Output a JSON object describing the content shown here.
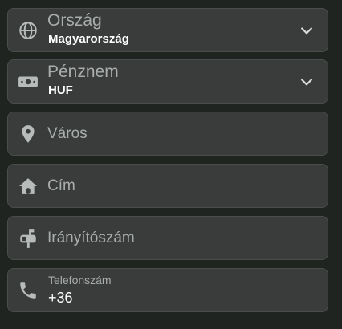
{
  "form": {
    "country": {
      "label": "Ország",
      "value": "Magyarország",
      "icon": "globe-icon"
    },
    "currency": {
      "label": "Pénznem",
      "value": "HUF",
      "icon": "banknote-icon"
    },
    "city": {
      "placeholder": "Város",
      "icon": "map-pin-icon"
    },
    "address": {
      "placeholder": "Cím",
      "icon": "home-icon"
    },
    "zip": {
      "placeholder": "Irányítószám",
      "icon": "mailbox-icon"
    },
    "phone": {
      "label": "Telefonszám",
      "value": "+36",
      "icon": "phone-icon"
    }
  },
  "colors": {
    "background": "#1f2420",
    "field": "#393c3b",
    "border": "#4a4d4c",
    "muted_text": "#a9adac",
    "text": "#ffffff"
  }
}
